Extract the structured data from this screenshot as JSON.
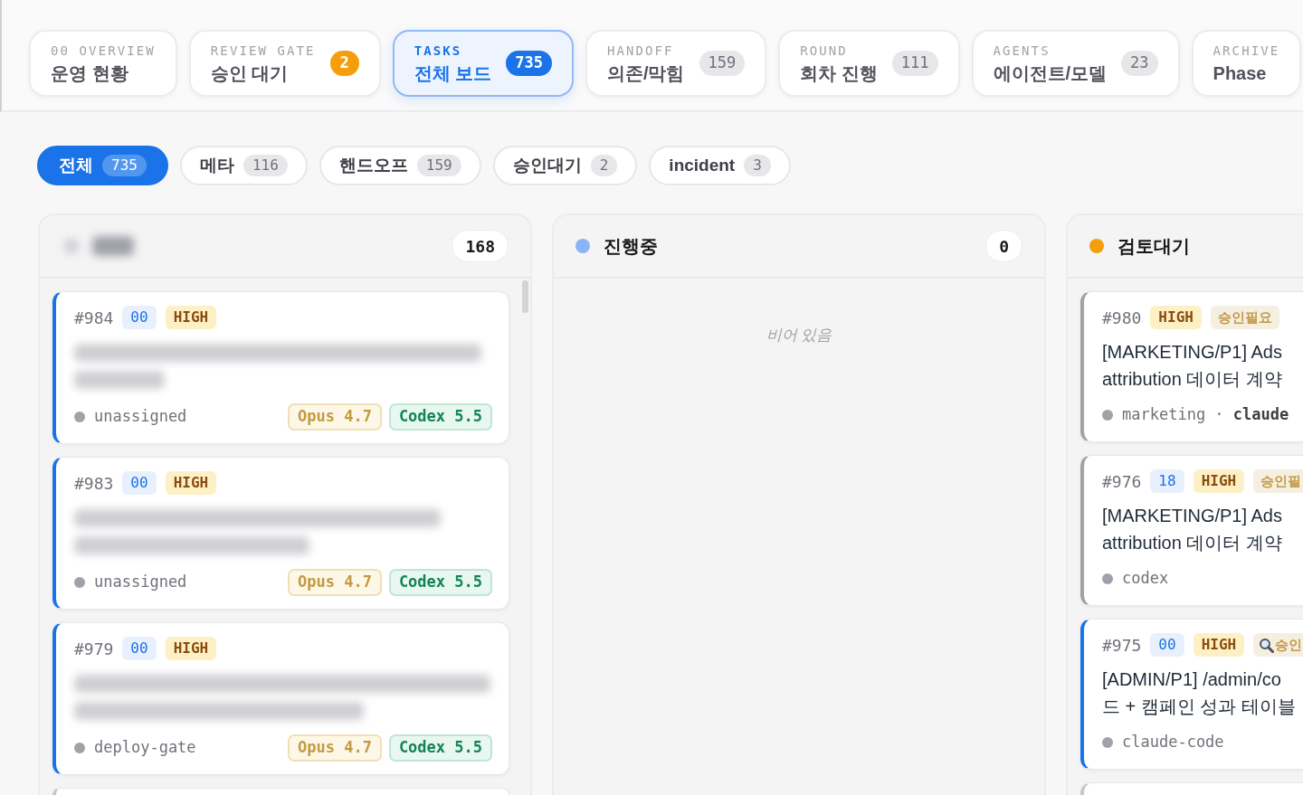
{
  "nav_tabs": [
    {
      "kicker": "00 OVERVIEW",
      "title": "운영 현황",
      "selected": false
    },
    {
      "kicker": "REVIEW GATE",
      "title": "승인 대기",
      "badge": {
        "text": "2",
        "kind": "warning"
      },
      "selected": false
    },
    {
      "kicker": "TASKS",
      "title": "전체 보드",
      "badge": {
        "text": "735",
        "kind": "neutral"
      },
      "selected": true
    },
    {
      "kicker": "HANDOFF",
      "title": "의존/막힘",
      "badge": {
        "text": "159",
        "kind": "neutral"
      },
      "selected": false
    },
    {
      "kicker": "ROUND",
      "title": "회차 진행",
      "badge": {
        "text": "111",
        "kind": "neutral"
      },
      "selected": false
    },
    {
      "kicker": "AGENTS",
      "title": "에이전트/모델",
      "badge": {
        "text": "23",
        "kind": "neutral"
      },
      "selected": false
    },
    {
      "kicker": "ARCHIVE",
      "title": "Phase",
      "selected": false
    }
  ],
  "filters": [
    {
      "label": "전체",
      "count": "735",
      "selected": true
    },
    {
      "label": "메타",
      "count": "116",
      "selected": false
    },
    {
      "label": "핸드오프",
      "count": "159",
      "selected": false
    },
    {
      "label": "승인대기",
      "count": "2",
      "selected": false
    },
    {
      "label": "incident",
      "count": "3",
      "selected": false
    }
  ],
  "columns": [
    {
      "title_blurred": true,
      "count": "168",
      "cards": [
        {
          "number": "#984",
          "color": "#1a73e8",
          "tags": [
            {
              "text": "00",
              "kind": "phase"
            },
            {
              "text": "HIGH",
              "kind": "priority"
            }
          ],
          "title_blurred": true,
          "meta": "unassigned",
          "models": [
            {
              "text": "Opus 4.7",
              "kind": "opus"
            },
            {
              "text": "Codex 5.5",
              "kind": "codex"
            }
          ]
        },
        {
          "number": "#983",
          "color": "#1a73e8",
          "tags": [
            {
              "text": "00",
              "kind": "phase"
            },
            {
              "text": "HIGH",
              "kind": "priority"
            }
          ],
          "title_blurred": true,
          "meta": "unassigned",
          "models": [
            {
              "text": "Opus 4.7",
              "kind": "opus"
            },
            {
              "text": "Codex 5.5",
              "kind": "codex"
            }
          ]
        },
        {
          "number": "#979",
          "color": "#1a73e8",
          "tags": [
            {
              "text": "00",
              "kind": "phase"
            },
            {
              "text": "HIGH",
              "kind": "priority"
            }
          ],
          "title_blurred": true,
          "meta": "deploy-gate",
          "models": [
            {
              "text": "Opus 4.7",
              "kind": "opus"
            },
            {
              "text": "Codex 5.5",
              "kind": "codex"
            }
          ]
        }
      ]
    },
    {
      "title": "진행중",
      "color": "#8ab4f8",
      "count": "0",
      "empty_text": "비어 있음"
    },
    {
      "title": "검토대기",
      "color": "#f59e0b",
      "cards": [
        {
          "number": "#980",
          "color": "#a1a1aa",
          "tags": [
            {
              "text": "HIGH",
              "kind": "priority"
            },
            {
              "text": "승인필요",
              "kind": "approval"
            }
          ],
          "title_lines": [
            "[MARKETING/P1] Ads",
            "attribution 데이터 계약"
          ],
          "meta": "marketing · **claude**"
        },
        {
          "number": "#976",
          "color": "#a1a1aa",
          "tags": [
            {
              "text": "18",
              "kind": "phase"
            },
            {
              "text": "HIGH",
              "kind": "priority"
            },
            {
              "text": "승인필",
              "kind": "approval"
            }
          ],
          "title_lines": [
            "[MARKETING/P1] Ads",
            "attribution 데이터 계약"
          ],
          "meta": "codex"
        },
        {
          "number": "#975",
          "color": "#1a73e8",
          "tags": [
            {
              "text": "00",
              "kind": "phase"
            },
            {
              "text": "HIGH",
              "kind": "priority"
            },
            {
              "text": "승인",
              "kind": "inspection"
            }
          ],
          "title_lines": [
            "[ADMIN/P1] /admin/co",
            "드 + 캠페인 성과 테이블"
          ],
          "meta": "claude-code"
        }
      ]
    }
  ]
}
